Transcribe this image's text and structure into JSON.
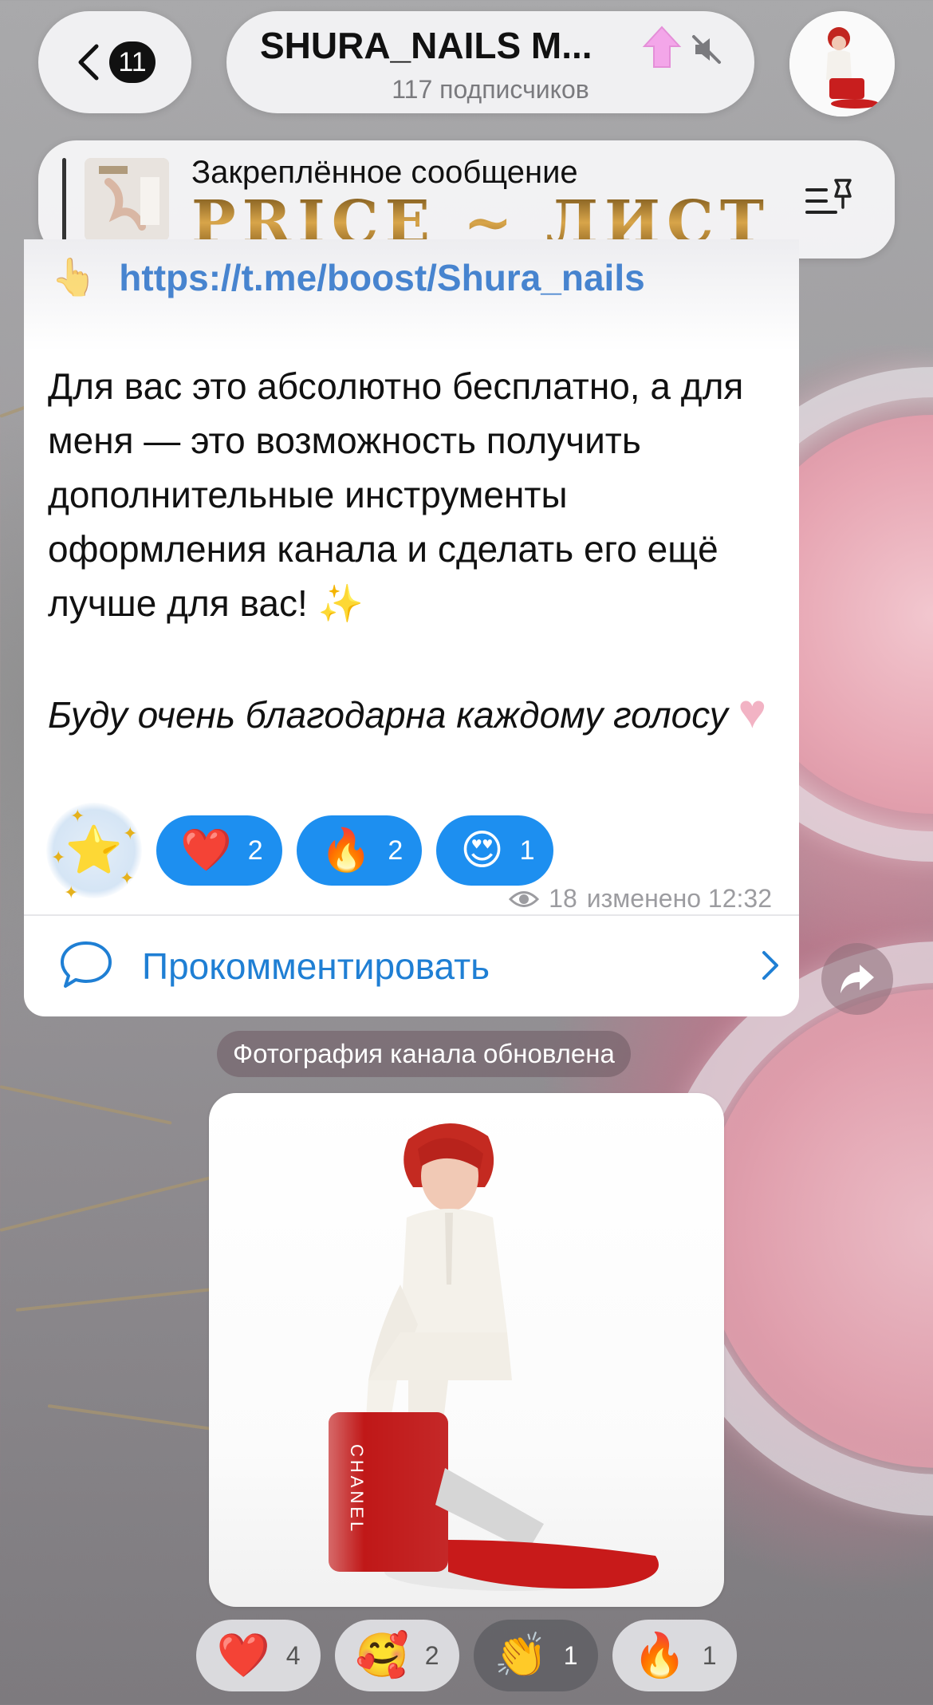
{
  "header": {
    "back_count": "11",
    "channel_title": "SHURA_NAILS M...",
    "subscribers": "117 подписчиков"
  },
  "pinned": {
    "label": "Закреплённое сообщение",
    "preview_text": "PRICE ~ ЛИСТ"
  },
  "message": {
    "link": "https://t.me/boost/Shura_nails",
    "body": "Для вас это абсолютно бесплатно, а для меня — это возможность получить дополнительные инструменты оформления канала и сделать его ещё лучше для вас! ✨",
    "italic": "Буду очень благодарна каждому голосу",
    "reactions": [
      {
        "emoji": "⭐",
        "count": ""
      },
      {
        "emoji": "❤️",
        "count": "2"
      },
      {
        "emoji": "🔥",
        "count": "2"
      },
      {
        "emoji": "😍",
        "count": "1"
      }
    ],
    "views": "18",
    "edited_time": "изменено 12:32",
    "comment_label": "Прокомментировать"
  },
  "service_message": "Фотография канала обновлена",
  "photo_reactions": [
    {
      "emoji": "❤️",
      "count": "4"
    },
    {
      "emoji": "🥰",
      "count": "2"
    },
    {
      "emoji": "👏",
      "count": "1"
    },
    {
      "emoji": "🔥",
      "count": "1"
    }
  ],
  "colors": {
    "accent_blue": "#1d8ff0",
    "link_blue": "#2a71c9",
    "pinned_gold": "#d8a54a"
  }
}
